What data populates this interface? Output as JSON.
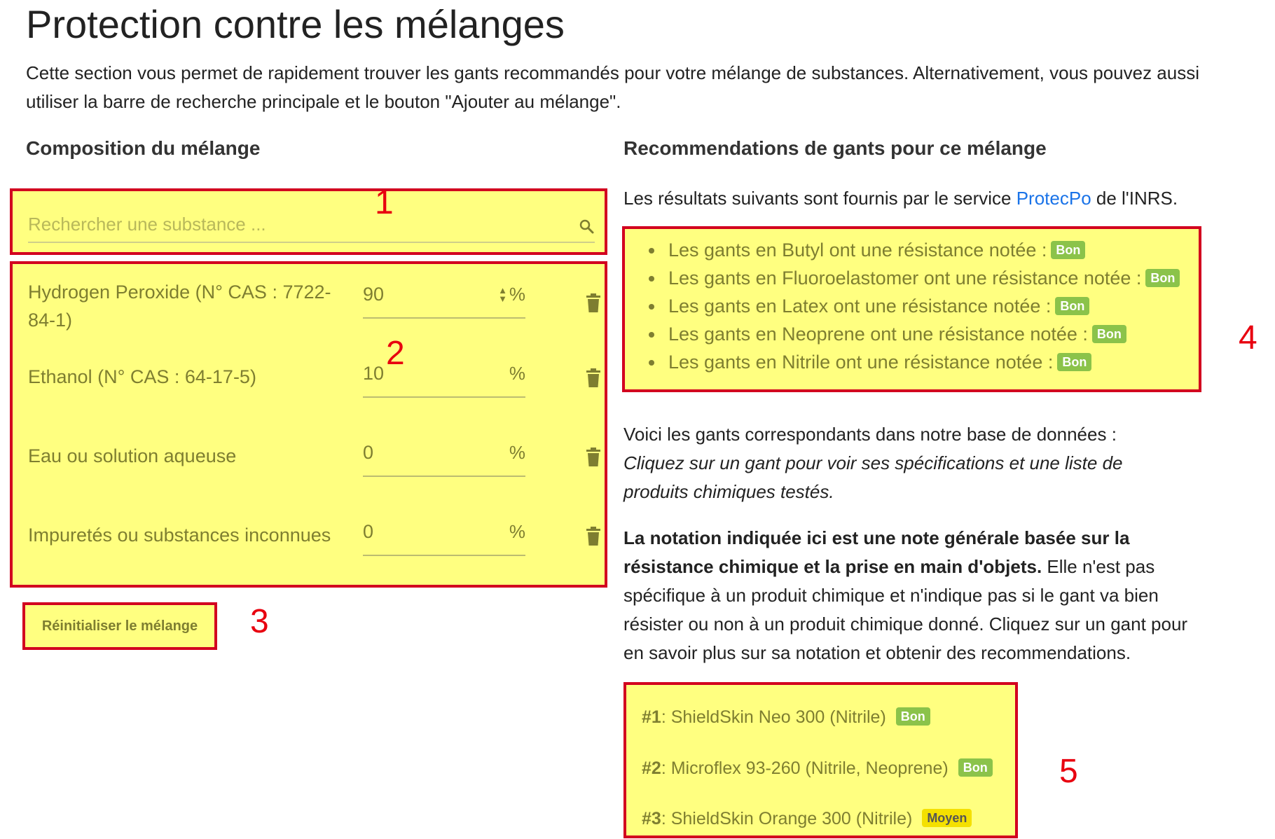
{
  "page": {
    "title": "Protection contre les mélanges",
    "intro": "Cette section vous permet de rapidement trouver les gants recommandés pour votre mélange de substances. Alternativement, vous pouvez aussi utiliser la barre de recherche principale et le bouton \"Ajouter au mélange\"."
  },
  "composition": {
    "heading": "Composition du mélange",
    "search_placeholder": "Rechercher une substance ...",
    "substances": [
      {
        "name": "Hydrogen Peroxide (N° CAS : 7722-84-1)",
        "percent": "90"
      },
      {
        "name": "Ethanol (N° CAS : 64-17-5)",
        "percent": "10"
      },
      {
        "name": "Eau ou solution aqueuse",
        "percent": "0"
      },
      {
        "name": "Impuretés ou substances inconnues",
        "percent": "0"
      }
    ],
    "percent_sign": "%",
    "reset_label": "Réinitialiser le mélange"
  },
  "recommendations": {
    "heading": "Recommendations de gants pour ce mélange",
    "source_prefix": "Les résultats suivants sont fournis par le service ",
    "source_link": "ProtecPo",
    "source_suffix": " de l'INRS.",
    "items": [
      {
        "text": "Les gants en Butyl ont une résistance notée :",
        "rating": "Bon"
      },
      {
        "text": "Les gants en Fluoroelastomer ont une résistance notée :",
        "rating": "Bon"
      },
      {
        "text": "Les gants en Latex ont une résistance notée :",
        "rating": "Bon"
      },
      {
        "text": "Les gants en Neoprene ont une résistance notée :",
        "rating": "Bon"
      },
      {
        "text": "Les gants en Nitrile ont une résistance notée :",
        "rating": "Bon"
      }
    ],
    "db_intro": "Voici les gants correspondants dans notre base de données :",
    "db_hint": "Cliquez sur un gant pour voir ses spécifications et une liste de produits chimiques testés.",
    "note_bold": "La notation indiquée ici est une note générale basée sur la résistance chimique et la prise en main d'objets.",
    "note_rest": " Elle n'est pas spécifique à un produit chimique et n'indique pas si le gant va bien résister ou non à un produit chimique donné. Cliquez sur un gant pour en savoir plus sur sa notation et obtenir des recommendations.",
    "gloves": [
      {
        "rank": "#1",
        "name": ": ShieldSkin Neo 300 (Nitrile)",
        "rating": "Bon"
      },
      {
        "rank": "#2",
        "name": ": Microflex 93-260 (Nitrile, Neoprene)",
        "rating": "Bon"
      },
      {
        "rank": "#3",
        "name": ": ShieldSkin Orange 300 (Nitrile)",
        "rating": "Moyen"
      }
    ]
  },
  "markers": [
    "1",
    "2",
    "3",
    "4",
    "5"
  ],
  "colors": {
    "highlight": "#ffff80",
    "border": "#d2001f",
    "marker": "#e8000f",
    "bon": "#8bc34a",
    "moyen": "#f4e000",
    "link": "#1a73e8"
  }
}
